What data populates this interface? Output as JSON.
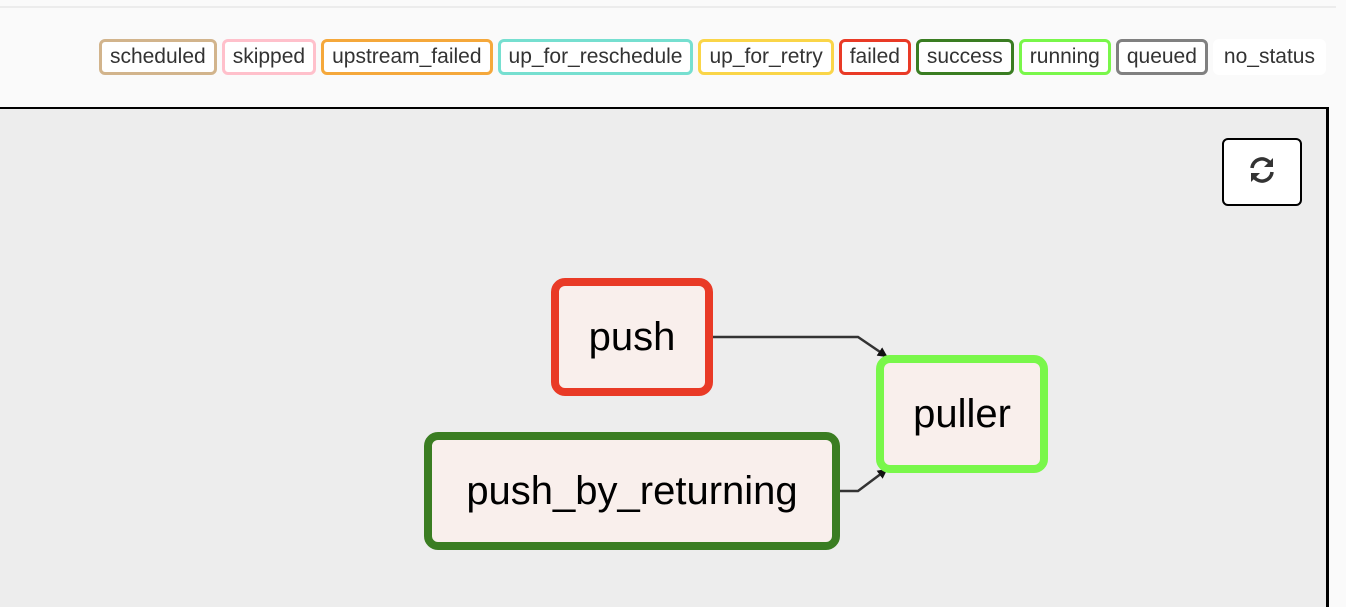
{
  "legend": [
    {
      "label": "scheduled",
      "color": "#d2b48c"
    },
    {
      "label": "skipped",
      "color": "#ffc0cb"
    },
    {
      "label": "upstream_failed",
      "color": "#f5a83b"
    },
    {
      "label": "up_for_reschedule",
      "color": "#76dfd0"
    },
    {
      "label": "up_for_retry",
      "color": "#fad548"
    },
    {
      "label": "failed",
      "color": "#e93a26"
    },
    {
      "label": "success",
      "color": "#3a7d22"
    },
    {
      "label": "running",
      "color": "#79f74a"
    },
    {
      "label": "queued",
      "color": "#808080"
    },
    {
      "label": "no_status",
      "color": "#ffffff"
    }
  ],
  "toolbar": {
    "refresh_icon": "refresh-icon"
  },
  "graph": {
    "nodes": [
      {
        "id": "push",
        "label": "push",
        "state": "failed",
        "color": "#e93a26"
      },
      {
        "id": "push_by_returning",
        "label": "push_by_returning",
        "state": "success",
        "color": "#3a7d22"
      },
      {
        "id": "puller",
        "label": "puller",
        "state": "running",
        "color": "#79f74a"
      }
    ],
    "edges": [
      {
        "from": "push",
        "to": "puller"
      },
      {
        "from": "push_by_returning",
        "to": "puller"
      }
    ]
  }
}
